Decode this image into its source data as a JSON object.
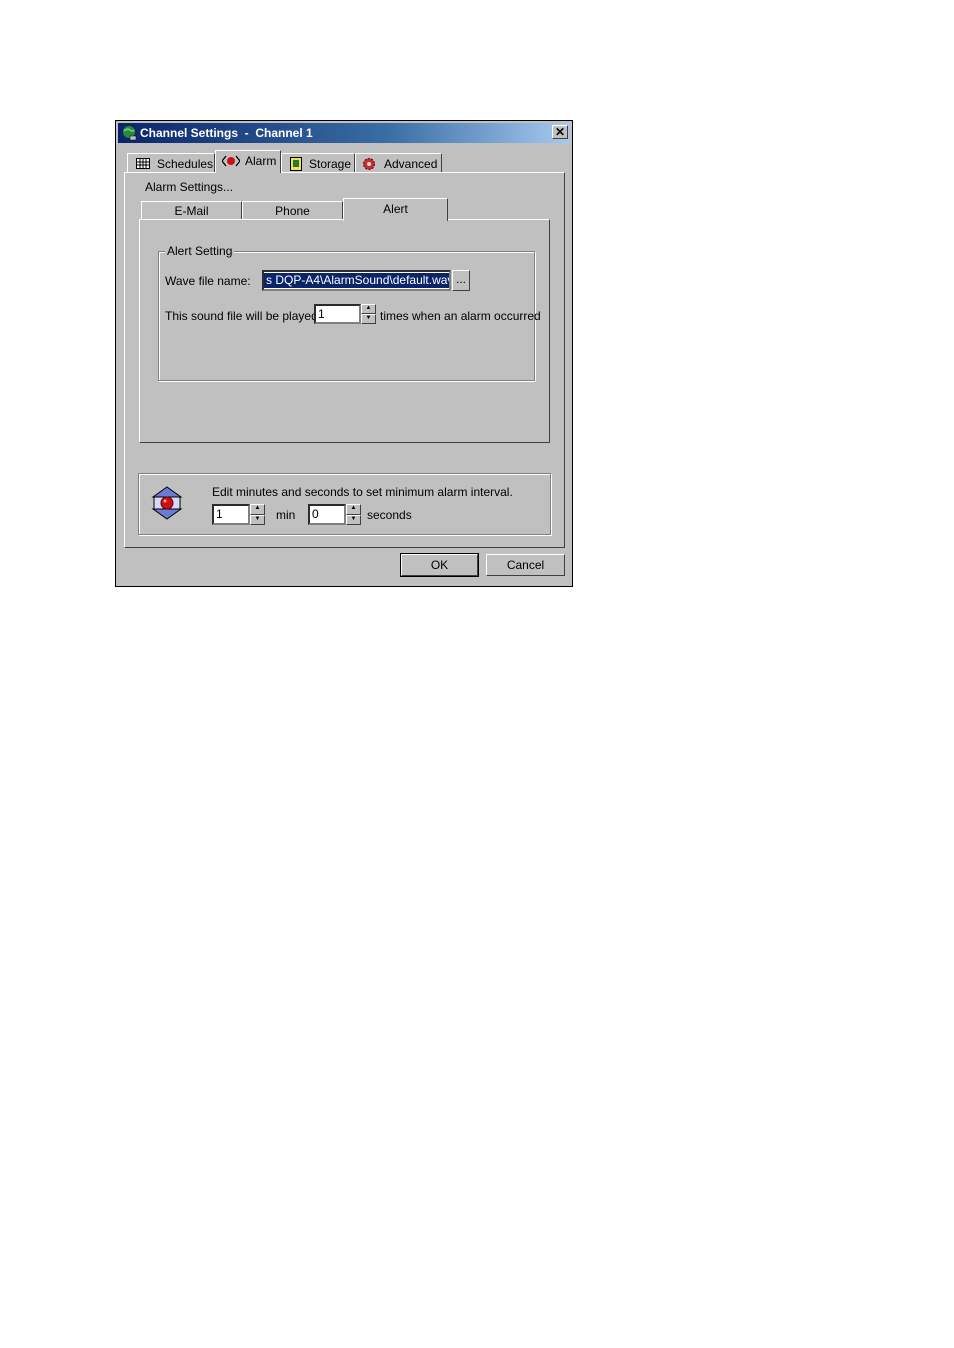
{
  "window": {
    "title": "Channel Settings  -  Channel 1",
    "close_glyph": "✕"
  },
  "main_tabs": [
    {
      "label": "Schedules",
      "icon": "grid-icon"
    },
    {
      "label": "Alarm",
      "icon": "alarm-icon",
      "active": true
    },
    {
      "label": "Storage",
      "icon": "storage-icon"
    },
    {
      "label": "Advanced",
      "icon": "gear-icon"
    }
  ],
  "alarm": {
    "section_label": "Alarm Settings...",
    "sub_tabs": [
      {
        "label": "E-Mail"
      },
      {
        "label": "Phone"
      },
      {
        "label": "Alert",
        "active": true
      }
    ],
    "alert_group": {
      "title": "Alert Setting",
      "wave_label": "Wave file name:",
      "wave_value": "s DQP-A4\\AlarmSound\\default.wav",
      "browse_label": "...",
      "played_label": "This sound file will be played",
      "played_value": "1",
      "played_suffix": "times when an alarm occurred"
    }
  },
  "interval": {
    "description": "Edit minutes and seconds to set minimum alarm interval.",
    "min_value": "1",
    "min_label": "min",
    "sec_value": "0",
    "sec_label": "seconds"
  },
  "buttons": {
    "ok": "OK",
    "cancel": "Cancel"
  },
  "colors": {
    "title_bar": "#0a246a",
    "face": "#c0c0c0",
    "selection": "#0a246a"
  }
}
